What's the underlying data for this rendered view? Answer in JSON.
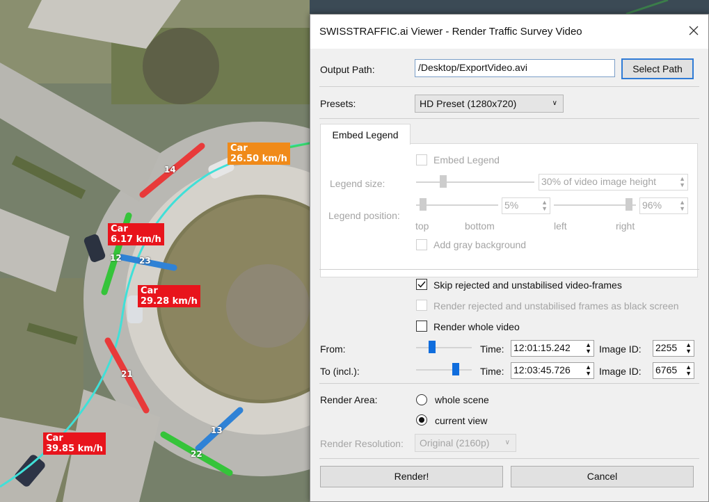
{
  "map": {
    "labels": [
      {
        "line1": "Car",
        "line2": "26.50 km/h",
        "color": "orange"
      },
      {
        "line1": "Car",
        "line2": "6.17 km/h",
        "color": "red"
      },
      {
        "line1": "Car",
        "line2": "29.28 km/h",
        "color": "red"
      },
      {
        "line1": "Car",
        "line2": "39.85 km/h",
        "color": "red"
      }
    ],
    "lane_numbers": [
      "14",
      "12",
      "23",
      "21",
      "13",
      "22"
    ]
  },
  "dialog": {
    "title": "SWISSTRAFFIC.ai Viewer - Render Traffic Survey Video",
    "output_path_label": "Output Path:",
    "output_path_value": "/Desktop/ExportVideo.avi",
    "select_path_label": "Select Path",
    "presets_label": "Presets:",
    "preset_value": "HD Preset (1280x720)",
    "tab_label": "Embed Legend",
    "legend": {
      "embed_label": "Embed Legend",
      "size_label": "Legend size:",
      "size_value": "30% of video image height",
      "position_label": "Legend position:",
      "vertical_value": "5%",
      "horizontal_value": "96%",
      "top_label": "top",
      "bottom_label": "bottom",
      "left_label": "left",
      "right_label": "right",
      "gray_bg_label": "Add gray background"
    },
    "skip_rejected_label": "Skip rejected and unstabilised video-frames",
    "skip_rejected_checked": true,
    "render_rejected_label": "Render rejected and unstabilised frames as black screen",
    "render_whole_label": "Render whole video",
    "from": {
      "label": "From:",
      "time_label": "Time:",
      "time": "12:01:15.242",
      "image_id_label": "Image ID:",
      "image_id": "2255",
      "slider": 0.25
    },
    "to": {
      "label": "To (incl.):",
      "time_label": "Time:",
      "time": "12:03:45.726",
      "image_id_label": "Image ID:",
      "image_id": "6765",
      "slider": 0.62
    },
    "render_area_label": "Render Area:",
    "whole_scene_label": "whole scene",
    "current_view_label": "current view",
    "render_area_selected": "current view",
    "resolution_label": "Render Resolution:",
    "resolution_value": "Original (2160p)",
    "render_button": "Render!",
    "cancel_button": "Cancel"
  },
  "colors": {
    "accent": "#0f6ddd",
    "tag_red": "#e8141c",
    "tag_orange": "#f08a19",
    "track_cyan": "#40e0d8"
  }
}
